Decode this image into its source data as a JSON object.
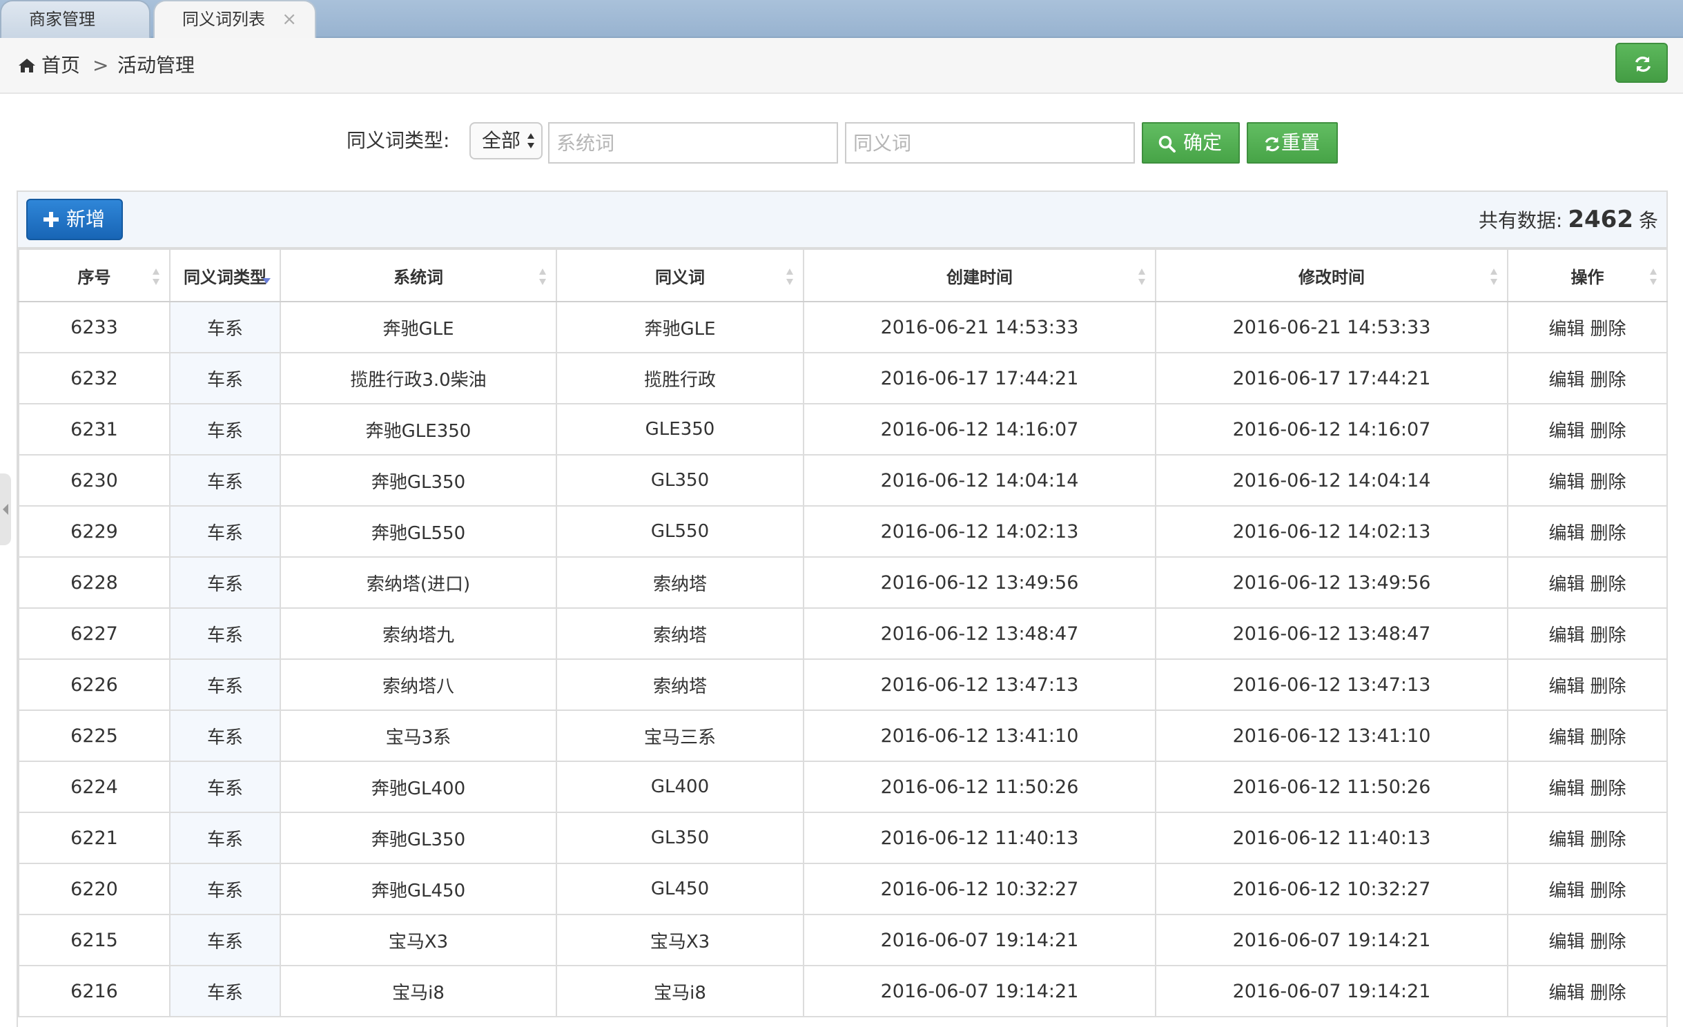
{
  "tabs": [
    {
      "label": "商家管理",
      "active": false
    },
    {
      "label": "同义词列表",
      "active": true,
      "close": "×"
    }
  ],
  "breadcrumb": {
    "home": "首页",
    "separator": ">",
    "current": "活动管理"
  },
  "filter": {
    "type_label": "同义词类型:",
    "type_selected": "全部",
    "system_word_placeholder": "系统词",
    "synonym_placeholder": "同义词",
    "confirm_label": "确定",
    "reset_label": "重置"
  },
  "toolbar": {
    "add_label": "新增",
    "total_prefix": "共有数据:",
    "total_count": "2462",
    "total_suffix": "条"
  },
  "table": {
    "columns": [
      "序号",
      "同义词类型",
      "系统词",
      "同义词",
      "创建时间",
      "修改时间",
      "操作"
    ],
    "rows": [
      {
        "id": "6233",
        "type": "车系",
        "system": "奔驰GLE",
        "synonym": "奔驰GLE",
        "created": "2016-06-21 14:53:33",
        "modified": "2016-06-21 14:53:33"
      },
      {
        "id": "6232",
        "type": "车系",
        "system": "揽胜行政3.0柴油",
        "synonym": "揽胜行政",
        "created": "2016-06-17 17:44:21",
        "modified": "2016-06-17 17:44:21"
      },
      {
        "id": "6231",
        "type": "车系",
        "system": "奔驰GLE350",
        "synonym": "GLE350",
        "created": "2016-06-12 14:16:07",
        "modified": "2016-06-12 14:16:07"
      },
      {
        "id": "6230",
        "type": "车系",
        "system": "奔驰GL350",
        "synonym": "GL350",
        "created": "2016-06-12 14:04:14",
        "modified": "2016-06-12 14:04:14"
      },
      {
        "id": "6229",
        "type": "车系",
        "system": "奔驰GL550",
        "synonym": "GL550",
        "created": "2016-06-12 14:02:13",
        "modified": "2016-06-12 14:02:13"
      },
      {
        "id": "6228",
        "type": "车系",
        "system": "索纳塔(进口)",
        "synonym": "索纳塔",
        "created": "2016-06-12 13:49:56",
        "modified": "2016-06-12 13:49:56"
      },
      {
        "id": "6227",
        "type": "车系",
        "system": "索纳塔九",
        "synonym": "索纳塔",
        "created": "2016-06-12 13:48:47",
        "modified": "2016-06-12 13:48:47"
      },
      {
        "id": "6226",
        "type": "车系",
        "system": "索纳塔八",
        "synonym": "索纳塔",
        "created": "2016-06-12 13:47:13",
        "modified": "2016-06-12 13:47:13"
      },
      {
        "id": "6225",
        "type": "车系",
        "system": "宝马3系",
        "synonym": "宝马三系",
        "created": "2016-06-12 13:41:10",
        "modified": "2016-06-12 13:41:10"
      },
      {
        "id": "6224",
        "type": "车系",
        "system": "奔驰GL400",
        "synonym": "GL400",
        "created": "2016-06-12 11:50:26",
        "modified": "2016-06-12 11:50:26"
      },
      {
        "id": "6221",
        "type": "车系",
        "system": "奔驰GL350",
        "synonym": "GL350",
        "created": "2016-06-12 11:40:13",
        "modified": "2016-06-12 11:40:13"
      },
      {
        "id": "6220",
        "type": "车系",
        "system": "奔驰GL450",
        "synonym": "GL450",
        "created": "2016-06-12 10:32:27",
        "modified": "2016-06-12 10:32:27"
      },
      {
        "id": "6215",
        "type": "车系",
        "system": "宝马X3",
        "synonym": "宝马X3",
        "created": "2016-06-07 19:14:21",
        "modified": "2016-06-07 19:14:21"
      },
      {
        "id": "6216",
        "type": "车系",
        "system": "宝马i8",
        "synonym": "宝马i8",
        "created": "2016-06-07 19:14:21",
        "modified": "2016-06-07 19:14:21"
      }
    ],
    "actions": {
      "edit": "编辑",
      "delete": "删除"
    }
  },
  "colors": {
    "accent_green": "#4cae4c",
    "accent_blue": "#1f6fc5",
    "tabstrip": "#a2bcd6"
  },
  "icons": [
    "home-icon",
    "refresh-icon",
    "search-icon",
    "plus-icon",
    "sort-icon",
    "close-icon"
  ]
}
